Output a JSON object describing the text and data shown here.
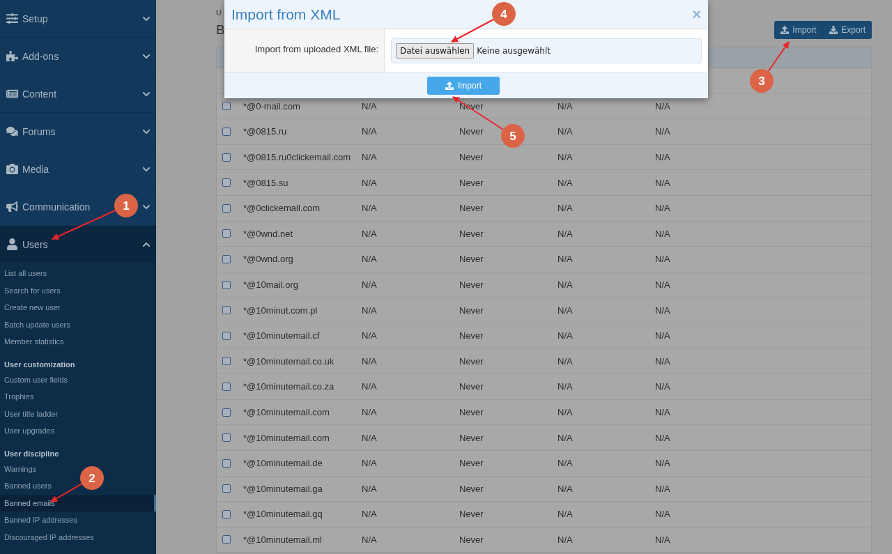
{
  "sidebar": {
    "sections": [
      {
        "label": "Setup",
        "expanded": false
      },
      {
        "label": "Add-ons",
        "expanded": false
      },
      {
        "label": "Content",
        "expanded": false
      },
      {
        "label": "Forums",
        "expanded": false
      },
      {
        "label": "Media",
        "expanded": false
      },
      {
        "label": "Communication",
        "expanded": false
      },
      {
        "label": "Users",
        "expanded": true,
        "groups": [
          {
            "items": [
              {
                "label": "List all users",
                "selected": false
              },
              {
                "label": "Search for users",
                "selected": false
              },
              {
                "label": "Create new user",
                "selected": false
              },
              {
                "label": "Batch update users",
                "selected": false
              },
              {
                "label": "Member statistics",
                "selected": false
              }
            ]
          },
          {
            "heading": "User customization",
            "items": [
              {
                "label": "Custom user fields",
                "selected": false
              },
              {
                "label": "Trophies",
                "selected": false
              },
              {
                "label": "User title ladder",
                "selected": false
              },
              {
                "label": "User upgrades",
                "selected": false
              }
            ]
          },
          {
            "heading": "User discipline",
            "items": [
              {
                "label": "Warnings",
                "selected": false
              },
              {
                "label": "Banned users",
                "selected": false
              },
              {
                "label": "Banned emails",
                "selected": true
              },
              {
                "label": "Banned IP addresses",
                "selected": false
              },
              {
                "label": "Discouraged IP addresses",
                "selected": false
              }
            ]
          }
        ]
      }
    ]
  },
  "main": {
    "breadcrumb": "U",
    "title": "B",
    "actions": [
      "Import",
      "Export"
    ],
    "rows": [
      {
        "email": "*@0-mail.com",
        "column_2": "N/A",
        "column_3": "Never",
        "column_4": "N/A",
        "column_5": "N/A",
        "checked": false
      },
      {
        "email": "*@0815.ru",
        "column_2": "N/A",
        "column_3": "Never",
        "column_4": "N/A",
        "column_5": "N/A",
        "checked": false
      },
      {
        "email": "*@0815.ru0clickemail.com",
        "column_2": "N/A",
        "column_3": "Never",
        "column_4": "N/A",
        "column_5": "N/A",
        "checked": false
      },
      {
        "email": "*@0815.su",
        "column_2": "N/A",
        "column_3": "Never",
        "column_4": "N/A",
        "column_5": "N/A",
        "checked": false
      },
      {
        "email": "*@0clickemail.com",
        "column_2": "N/A",
        "column_3": "Never",
        "column_4": "N/A",
        "column_5": "N/A",
        "checked": false
      },
      {
        "email": "*@0wnd.net",
        "column_2": "N/A",
        "column_3": "Never",
        "column_4": "N/A",
        "column_5": "N/A",
        "checked": false
      },
      {
        "email": "*@0wnd.org",
        "column_2": "N/A",
        "column_3": "Never",
        "column_4": "N/A",
        "column_5": "N/A",
        "checked": false
      },
      {
        "email": "*@10mail.org",
        "column_2": "N/A",
        "column_3": "Never",
        "column_4": "N/A",
        "column_5": "N/A",
        "checked": false
      },
      {
        "email": "*@10minut.com.pl",
        "column_2": "N/A",
        "column_3": "Never",
        "column_4": "N/A",
        "column_5": "N/A",
        "checked": false
      },
      {
        "email": "*@10minutemail.cf",
        "column_2": "N/A",
        "column_3": "Never",
        "column_4": "N/A",
        "column_5": "N/A",
        "checked": false
      },
      {
        "email": "*@10minutemail.co.uk",
        "column_2": "N/A",
        "column_3": "Never",
        "column_4": "N/A",
        "column_5": "N/A",
        "checked": false
      },
      {
        "email": "*@10minutemail.co.za",
        "column_2": "N/A",
        "column_3": "Never",
        "column_4": "N/A",
        "column_5": "N/A",
        "checked": false
      },
      {
        "email": "*@10minutemail.com",
        "column_2": "N/A",
        "column_3": "Never",
        "column_4": "N/A",
        "column_5": "N/A",
        "checked": false
      },
      {
        "email": "*@10minutemail.com",
        "column_2": "N/A",
        "column_3": "Never",
        "column_4": "N/A",
        "column_5": "N/A",
        "checked": false
      },
      {
        "email": "*@10minutemail.de",
        "column_2": "N/A",
        "column_3": "Never",
        "column_4": "N/A",
        "column_5": "N/A",
        "checked": false
      },
      {
        "email": "*@10minutemail.ga",
        "column_2": "N/A",
        "column_3": "Never",
        "column_4": "N/A",
        "column_5": "N/A",
        "checked": false
      },
      {
        "email": "*@10minutemail.gq",
        "column_2": "N/A",
        "column_3": "Never",
        "column_4": "N/A",
        "column_5": "N/A",
        "checked": false
      },
      {
        "email": "*@10minutemail.ml",
        "column_2": "N/A",
        "column_3": "Never",
        "column_4": "N/A",
        "column_5": "N/A",
        "checked": false
      }
    ]
  },
  "dialog": {
    "title": "Import from XML",
    "close": "×",
    "field_label": "Import from uploaded XML file:",
    "file_button": "Datei auswählen",
    "file_status": "Keine ausgewählt",
    "submit": "Import"
  },
  "annotations": [
    "1",
    "2",
    "3",
    "4",
    "5"
  ]
}
